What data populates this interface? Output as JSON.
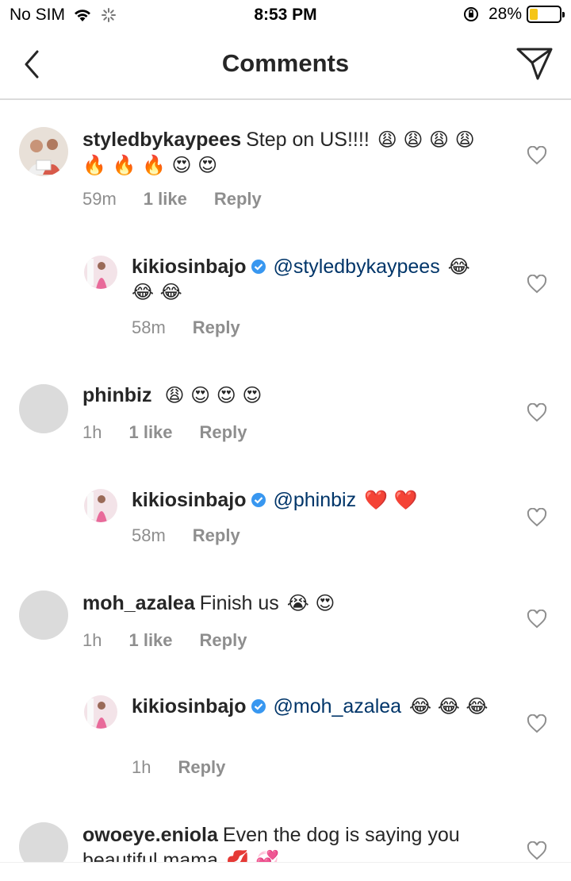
{
  "status": {
    "carrier": "No SIM",
    "time": "8:53 PM",
    "battery": "28%",
    "battery_level": 0.28
  },
  "nav": {
    "title": "Comments"
  },
  "comments": [
    {
      "user": "styledbykaypees",
      "text": "Step on US!!!!",
      "emojis": "😩 😩 😩 😩 🔥 🔥 🔥 😍 😍",
      "time": "59m",
      "likes": "1 like",
      "reply": "Reply"
    },
    {
      "user": "kikiosinbajo",
      "mention": "@styledbykaypees",
      "emojis": "😂 😂 😂",
      "time": "58m",
      "reply": "Reply"
    },
    {
      "user": "phinbiz",
      "emojis": "😩 😍 😍 😍",
      "time": "1h",
      "likes": "1 like",
      "reply": "Reply"
    },
    {
      "user": "kikiosinbajo",
      "mention": "@phinbiz",
      "emojis": "❤️ ❤️",
      "time": "58m",
      "reply": "Reply"
    },
    {
      "user": "moh_azalea",
      "text": "Finish us",
      "emojis": "😭 😍",
      "time": "1h",
      "likes": "1 like",
      "reply": "Reply"
    },
    {
      "user": "kikiosinbajo",
      "mention": "@moh_azalea",
      "emojis": "😂 😂 😂",
      "time": "1h",
      "reply": "Reply"
    },
    {
      "user": "owoeye.eniola",
      "text": "Even the dog is saying you beautiful mama",
      "emojis": "💋 💞"
    }
  ]
}
